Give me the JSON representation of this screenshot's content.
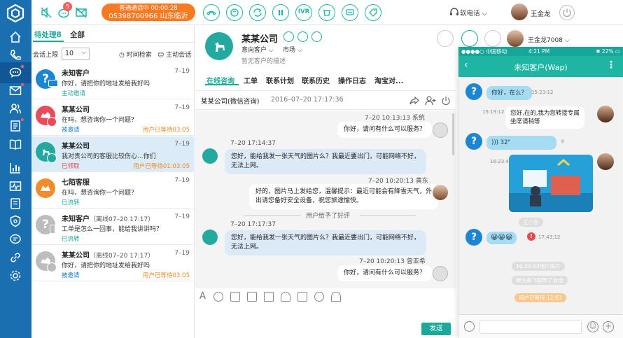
{
  "topbar": {
    "notif_count": "5",
    "call_status": "普通通话中 00:00:28",
    "call_number": "05398700966 山东临沂",
    "ivr_label": "IVR",
    "softphone_label": "软电话",
    "user_name": "王金龙"
  },
  "sessions": {
    "tab_pending": "待处理8",
    "tab_all": "全部",
    "limit_label": "会话上限",
    "limit_value": "10",
    "time_search": "时间检索",
    "active_invite": "主动会话",
    "items": [
      {
        "name": "未知客户",
        "note": "",
        "time": "7–19",
        "msg": "你好，请把你的地址发给我好吗",
        "status": "主动邀请",
        "wait": ""
      },
      {
        "name": "某某公司",
        "note": "",
        "time": "7–19",
        "msg": "在吗，想咨询你一个问题？",
        "status": "被邀请",
        "wait": "用户已等待03:05"
      },
      {
        "name": "某某公司",
        "note": "",
        "time": "7–19",
        "msg": "我对贵公司的客服比较伤心...你们",
        "status": "已领取",
        "wait": "用户已等待01:03:05"
      },
      {
        "name": "七陌客服",
        "note": "",
        "time": "7–19",
        "msg": "在吗，想咨询你一个问题？",
        "status": "已流转",
        "wait": ""
      },
      {
        "name": "未知客户",
        "note": "（离线07–20 17:17）",
        "time": "7–19",
        "msg": "工单是怎么一回事，能给我讲讲吗？",
        "status": "已流转",
        "wait": ""
      },
      {
        "name": "某某公司",
        "note": "（离线07–20 17:17）",
        "time": "7–19",
        "msg": "你好，请把你的地址发给我好吗",
        "status": "被邀请",
        "wait": "用户已等待03:05"
      }
    ]
  },
  "chat": {
    "customer_name": "某某公司",
    "intent": "意向客户",
    "market": "市场",
    "description": "暂无客户的描述",
    "agent_name": "王金龙7008",
    "tabs": [
      "在线咨询",
      "工单",
      "联系计划",
      "联系历史",
      "操作日志",
      "淘宝对..."
    ],
    "conv_title": "某某公司(微信咨询)",
    "conv_time": "2016–07–20 17:17:36",
    "messages": [
      {
        "meta": "7–20 10:13:13 系统",
        "lines": [
          "你好，请问有什么可以服务？"
        ]
      },
      {
        "meta": "7–20 17:14:37",
        "lines": [
          "您好，能给我发一张天气的图片么？我最近要出门，可能网络不好，",
          "无法上网。"
        ]
      },
      {
        "meta": "7–20 10:20:13 黄东",
        "lines": [
          "好的，图片马上发给您，温馨提示：最近可能会有降雪天气，外",
          "出请您备好安全设备，祝您旅途愉快。"
        ]
      },
      {
        "meta": "7–20 17:17:37",
        "lines": [
          "您好，能给我发一张天气的图片么？我最近要出门，可能网络不好，",
          "无法上网。"
        ]
      },
      {
        "meta": "7–20 10:20:13 曾亚希",
        "lines": [
          "你好，请问有什么可以服务？"
        ]
      }
    ],
    "rating_notice": "用户给予了好评",
    "send_label": "发送"
  },
  "wap": {
    "carrier": "●●●●○ 中国移动",
    "clock": "4:21 PM",
    "battery": "✱ 22% ▭",
    "title": "未知客户(Wap)",
    "m1": "你好，在么？",
    "t1": "15:23:12",
    "t2": "15:19:12",
    "m2_l1": "您好,在的,我为您转接专属",
    "m2_l2": "坐席请稍等",
    "voice": "32\"",
    "t3": "16:23:43",
    "t4": "17:43:12",
    "emoji": "😀😀😀",
    "pill1": "王小宝",
    "pill2": "16:34:33用户离开",
    "pill3": "被向南飞取到了会话",
    "pill4": "用户已等待 12:03"
  }
}
